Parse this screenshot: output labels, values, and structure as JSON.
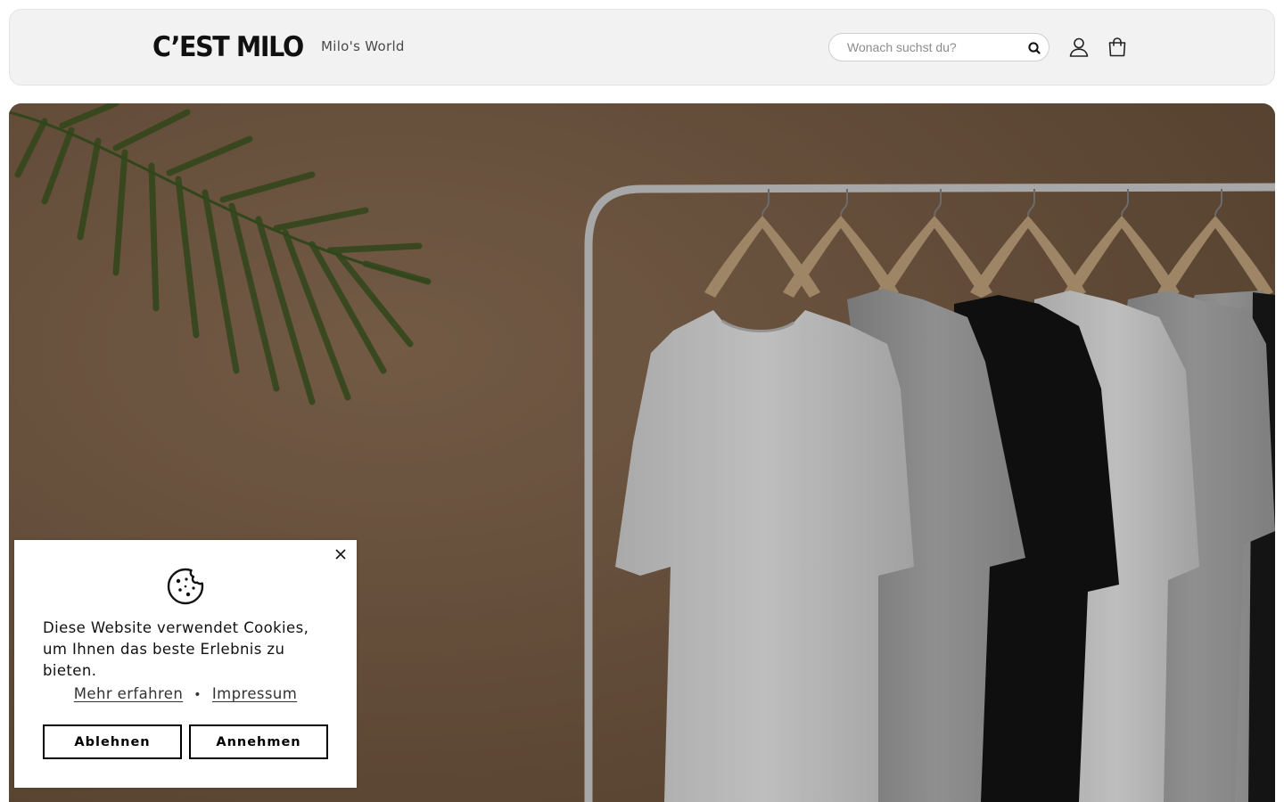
{
  "header": {
    "logo_text": "C’EST MILO",
    "nav": [
      {
        "label": "Milo's World"
      }
    ],
    "search": {
      "placeholder": "Wonach suchst du?",
      "value": ""
    },
    "icons": {
      "search": "search-icon",
      "account": "user-icon",
      "cart": "shopping-bag-icon"
    }
  },
  "hero": {
    "image": "t-shirts-on-clothing-rack-with-palm-leaf"
  },
  "cookie_banner": {
    "icon": "cookie-icon",
    "message": "Diese Website verwendet Cookies, um Ihnen das beste Erlebnis zu bieten.",
    "links": [
      {
        "label": "Mehr erfahren"
      },
      {
        "label": "Impressum"
      }
    ],
    "separator": "•",
    "decline_label": "Ablehnen",
    "accept_label": "Annehmen",
    "close_icon": "close-icon"
  },
  "colors": {
    "header_bg": "#f2f2f2",
    "hero_bg": "#7e6247",
    "button_border": "#000000",
    "text": "#121212"
  }
}
